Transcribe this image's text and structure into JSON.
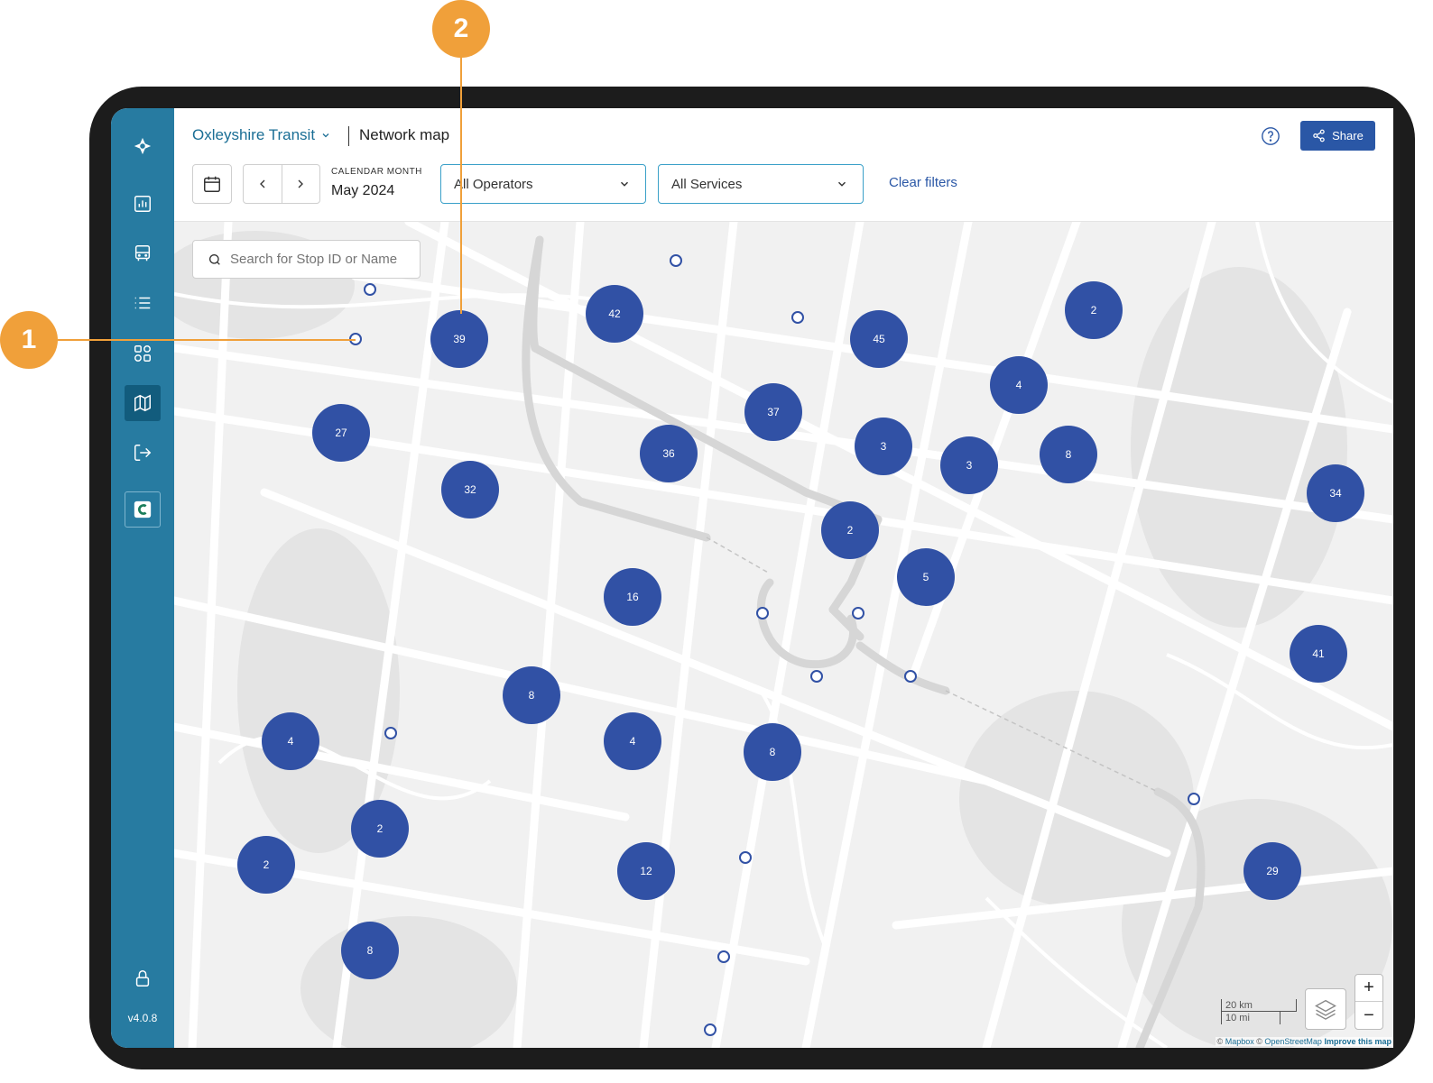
{
  "header": {
    "org_name": "Oxleyshire Transit",
    "page_title": "Network map",
    "share_label": "Share"
  },
  "filters": {
    "month_label": "CALENDAR MONTH",
    "month_value": "May 2024",
    "operators": "All Operators",
    "services": "All Services",
    "clear_label": "Clear filters"
  },
  "search": {
    "placeholder": "Search for Stop ID or Name"
  },
  "sidebar": {
    "items": [
      "logo-icon",
      "chart-icon",
      "bus-icon",
      "list-icon",
      "apps-icon",
      "map-icon",
      "logout-icon",
      "app-badge-icon",
      "lock-icon"
    ],
    "active": "map-icon",
    "version": "v4.0.8"
  },
  "map": {
    "clusters": [
      "42",
      "39",
      "45",
      "2",
      "4",
      "37",
      "27",
      "36",
      "3",
      "3",
      "8",
      "32",
      "34",
      "2",
      "5",
      "16",
      "41",
      "8",
      "4",
      "4",
      "8",
      "2",
      "2",
      "12",
      "29",
      "8"
    ],
    "scale_metric": "20 km",
    "scale_imperial": "10 mi",
    "attribution": {
      "copy1": "©",
      "mapbox": "Mapbox",
      "copy2": "©",
      "osm": "OpenStreetMap",
      "improve": "Improve this map"
    },
    "zoom_in": "+",
    "zoom_out": "−"
  },
  "callouts": [
    "1",
    "2"
  ],
  "colors": {
    "sidebar": "#277ba1",
    "sidebar_active": "#125c7d",
    "primary": "#2a57a6",
    "cluster": "#3151a5",
    "callout": "#f0a03a"
  }
}
